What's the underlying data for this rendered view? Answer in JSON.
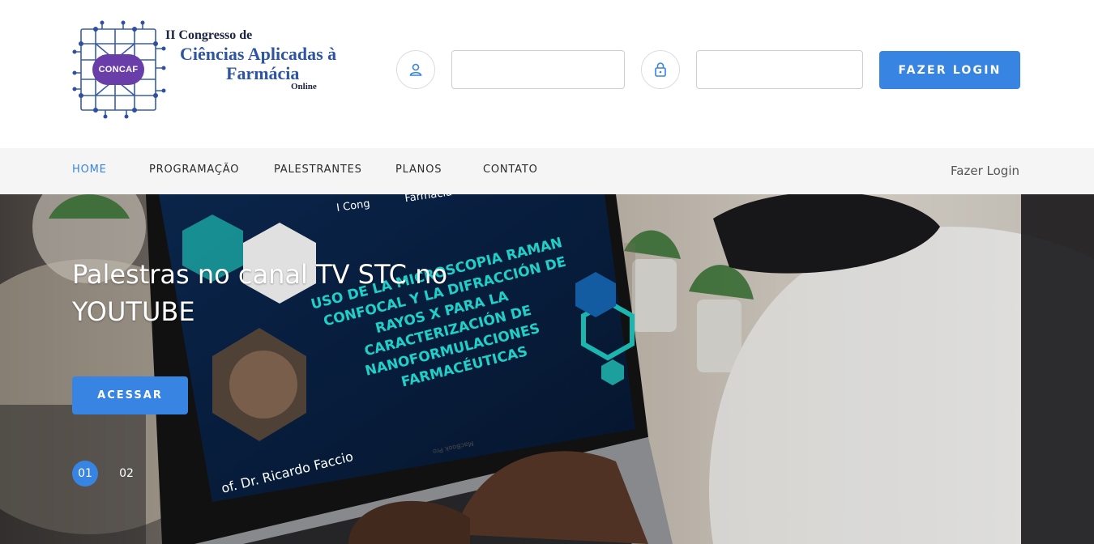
{
  "logo": {
    "badge": "CONCAF",
    "line1": "II Congresso de",
    "line2": "Ciências Aplicadas à",
    "line3": "Farmácia",
    "line4": "Online"
  },
  "login": {
    "user_icon": "user-icon",
    "lock_icon": "lock-icon",
    "username_value": "",
    "password_value": "",
    "button_label": "FAZER LOGIN"
  },
  "nav": {
    "items": [
      {
        "label": "HOME",
        "active": true
      },
      {
        "label": "PROGRAMAÇÃO",
        "active": false
      },
      {
        "label": "PALESTRANTES",
        "active": false
      },
      {
        "label": "PLANOS",
        "active": false
      },
      {
        "label": "CONTATO",
        "active": false
      }
    ],
    "login_link": "Fazer Login"
  },
  "hero": {
    "title": "Palestras no canal TV STC no YOUTUBE",
    "button_label": "ACESSAR",
    "slides": [
      "01",
      "02"
    ],
    "active_slide": "01",
    "screen_title": "USO DE LA MICROSCOPIA RAMAN CONFOCAL Y LA DIFRACCIÓN DE RAYOS X PARA LA CARACTERIZACIÓN DE NANOFORMULACIONES FARMACÉUTICAS",
    "screen_speaker": "of. Dr. Ricardo Faccio",
    "screen_header_a": "I Cong",
    "screen_header_b": "Farmácia",
    "laptop_brand": "MacBook Pro"
  },
  "colors": {
    "accent": "#3784e3",
    "nav_bg": "#f5f5f5",
    "logo_blue": "#2e55a1"
  }
}
